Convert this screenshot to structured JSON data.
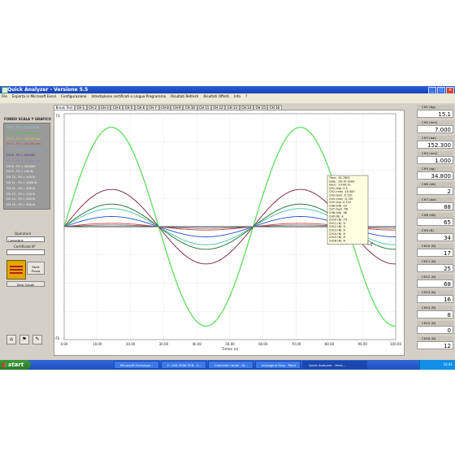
{
  "window": {
    "title": "Quick Analyzer - Versione 5.5"
  },
  "menu": [
    "File",
    "Esporta in Microsoft Excel",
    "Configurazione",
    "Intestazione certificati e Lingua Programma",
    "Risultati Refresh",
    "Risultati Offerti",
    "Info",
    "?"
  ],
  "left_panel": {
    "title": "FONDO SCALA Y GRAFICO",
    "fullscale": [
      {
        "text": "CH 1 - FS = 1000.0 Kg",
        "color": "#7fd4e8"
      },
      {
        "text": "CH 2 - FS = 20.000 mm",
        "color": "#33cc33"
      },
      {
        "text": "CH 3 - FS = 500.00 bar",
        "color": "#e0d040"
      },
      {
        "text": "CH 4 - FS = 20.000 mm",
        "color": "#c04040"
      },
      {
        "text": "CH 5 - FS = 60000.00 kg",
        "color": "#7fa8e8"
      },
      {
        "text": "CH 6 - FS = 400000",
        "color": "#303080"
      },
      {
        "text": "CH 7 - FS = 100000 bar",
        "color": "#8080c0"
      },
      {
        "text": "CH 8 - FS = 400000",
        "color": "#ffffff"
      },
      {
        "text": "CH 9 - FS = 100 N",
        "color": "#ffffff"
      },
      {
        "text": "CH 10 - FS = 100 N",
        "color": "#ffffff"
      },
      {
        "text": "CH 11 - FS = 1000 N",
        "color": "#ffffff"
      },
      {
        "text": "CH 12 - FS = 100 N",
        "color": "#ffffff"
      },
      {
        "text": "CH 13 - FS = 110 N",
        "color": "#ffffff"
      },
      {
        "text": "CH 14 - FS = 250 N",
        "color": "#ffffff"
      },
      {
        "text": "CH 15 - FS = 500 N",
        "color": "#ffffff"
      }
    ],
    "operator_label": "Operatore",
    "operator_value": "Consegne",
    "certificate_label": "Certificato N°",
    "start_label_1": "Start",
    "start_label_2": "Prova",
    "zero_label": "Zero Canali"
  },
  "tabs": [
    "Break Test",
    "CH 1",
    "CH 2",
    "CH 3",
    "CH 4",
    "CH 5",
    "CH 6",
    "CH 7",
    "CH 8",
    "CH 9",
    "CH 10",
    "CH 11",
    "CH 12",
    "CH 13",
    "CH 14",
    "CH 15",
    "CH 16"
  ],
  "channels": [
    {
      "label": "CH1 (Kg)",
      "value": "15.1"
    },
    {
      "label": "CH2 (mm)",
      "value": "7.000"
    },
    {
      "label": "CH3 (bar)",
      "value": "152.300"
    },
    {
      "label": "CH4 (mm)",
      "value": "1.000"
    },
    {
      "label": "CH5 (kg)",
      "value": "34.800"
    },
    {
      "label": "CH6 (kN)",
      "value": "2"
    },
    {
      "label": "CH7 (bar)",
      "value": "88"
    },
    {
      "label": "CH8 (kN)",
      "value": "65"
    },
    {
      "label": "CH9 (N)",
      "value": "34"
    },
    {
      "label": "CH10 (N)",
      "value": "17"
    },
    {
      "label": "CH11 (N)",
      "value": "25"
    },
    {
      "label": "CH12 (N)",
      "value": "68"
    },
    {
      "label": "CH13 (N)",
      "value": "16"
    },
    {
      "label": "CH14 (N)",
      "value": "8"
    },
    {
      "label": "CH15 (N)",
      "value": "0"
    },
    {
      "label": "CH16 (N)",
      "value": "12"
    }
  ],
  "tooltip": [
    "Time : 91.7902",
    "Date : 26-10-2009",
    "Hour : 10:40:31",
    "CH1 (Kg) :0.5",
    "CH2 (mm) :15.400",
    "CH3 (bar) :0.720",
    "CH4 (mm) :0.720",
    "CH5 (kg) :0.720",
    "CH6 (kN) :20",
    "CH7 (bar) :46",
    "CH8 (kN) :38",
    "CH9 (N) :4",
    "CH10 (N) :74",
    "CH11 (N) :0",
    "CH12 (N) :3",
    "CH13 (N) :0",
    "CH14 (N) :0",
    "CH15 (N) :0",
    "CH16 (N) :0"
  ],
  "chart_data": {
    "type": "line",
    "xlabel": "Times (s)",
    "x_ticks": [
      "0.00",
      "10.00",
      "20.00",
      "30.00",
      "40.00",
      "50.00",
      "60.00",
      "70.00",
      "80.00",
      "90.00",
      "100.00"
    ],
    "y_top_label": "FS",
    "y_bottom_label": "-FS",
    "xlim": [
      0,
      100
    ],
    "ylim": [
      -1,
      1
    ],
    "series": [
      {
        "color": "#66e066",
        "amplitude": 0.88,
        "period": 57
      },
      {
        "color": "#7a1f3a",
        "amplitude": 0.33,
        "period": 57
      },
      {
        "color": "#1a6a2a",
        "amplitude": 0.2,
        "period": 57
      },
      {
        "color": "#3cc0a0",
        "amplitude": 0.16,
        "period": 57
      },
      {
        "color": "#2050d0",
        "amplitude": 0.09,
        "period": 57
      },
      {
        "color": "#d04040",
        "amplitude": 0.03,
        "period": 57
      },
      {
        "color": "#707070",
        "amplitude": 0.015,
        "period": 57
      }
    ]
  },
  "taskbar": {
    "start_label": "start",
    "items": [
      "Microsoft Exchange...",
      "F: CAD 2006 PCB - S...",
      "Controllo Canali - M...",
      "Immagine Stop - Paint",
      "Quick Analyzer - Versi..."
    ],
    "clock": "10:41"
  }
}
